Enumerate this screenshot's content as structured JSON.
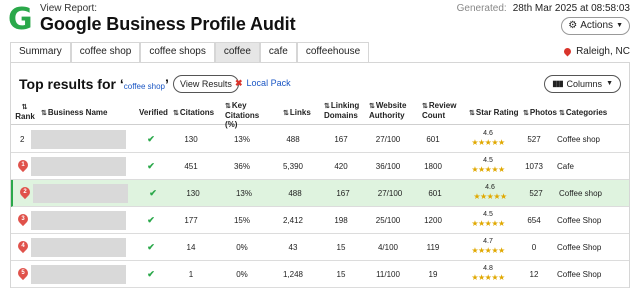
{
  "header": {
    "view_report": "View Report:",
    "title": "Google Business Profile Audit",
    "generated_label": "Generated:",
    "generated_date": "28th Mar 2025 at 08:58:03",
    "actions_label": "Actions"
  },
  "tabs": [
    {
      "label": "Summary",
      "active": false
    },
    {
      "label": "coffee shop",
      "active": false
    },
    {
      "label": "coffee shops",
      "active": false
    },
    {
      "label": "cafe",
      "active": true
    },
    {
      "label": "cafe",
      "active": false
    },
    {
      "label": "coffeehouse",
      "active": false
    }
  ],
  "location": "Raleigh, NC",
  "panel": {
    "heading": "Top results for",
    "keyword": "coffee shop",
    "view_results_label": "View Results",
    "local_pack_label": "Local Pack",
    "columns_label": "Columns"
  },
  "columns": {
    "rank": "Rank",
    "business_name": "Business Name",
    "verified": "Verified",
    "citations": "Citations",
    "key_citations": "Key Citations (%)",
    "links": "Links",
    "linking_domains": "Linking Domains",
    "website_authority": "Website Authority",
    "review_count": "Review Count",
    "star_rating": "Star Rating",
    "photos": "Photos",
    "categories": "Categories"
  },
  "rows": [
    {
      "rank": "2",
      "pinned": false,
      "verified": "✔",
      "citations": "130",
      "key_citations": "13%",
      "links": "488",
      "linking_domains": "167",
      "website_authority": "27/100",
      "review_count": "601",
      "rating": "4.6",
      "stars": "★★★★★",
      "photos": "527",
      "category": "Coffee shop",
      "highlight": false
    },
    {
      "rank": "1",
      "pinned": true,
      "verified": "✔",
      "citations": "451",
      "key_citations": "36%",
      "links": "5,390",
      "linking_domains": "420",
      "website_authority": "36/100",
      "review_count": "1800",
      "rating": "4.5",
      "stars": "★★★★★",
      "photos": "1073",
      "category": "Cafe",
      "highlight": false
    },
    {
      "rank": "2",
      "pinned": true,
      "verified": "✔",
      "citations": "130",
      "key_citations": "13%",
      "links": "488",
      "linking_domains": "167",
      "website_authority": "27/100",
      "review_count": "601",
      "rating": "4.6",
      "stars": "★★★★★",
      "photos": "527",
      "category": "Coffee shop",
      "highlight": true
    },
    {
      "rank": "3",
      "pinned": true,
      "verified": "✔",
      "citations": "177",
      "key_citations": "15%",
      "links": "2,412",
      "linking_domains": "198",
      "website_authority": "25/100",
      "review_count": "1200",
      "rating": "4.5",
      "stars": "★★★★★",
      "photos": "654",
      "category": "Coffee Shop",
      "highlight": false
    },
    {
      "rank": "4",
      "pinned": true,
      "verified": "✔",
      "citations": "14",
      "key_citations": "0%",
      "links": "43",
      "linking_domains": "15",
      "website_authority": "4/100",
      "review_count": "119",
      "rating": "4.7",
      "stars": "★★★★★",
      "photos": "0",
      "category": "Coffee Shop",
      "highlight": false
    },
    {
      "rank": "5",
      "pinned": true,
      "verified": "✔",
      "citations": "1",
      "key_citations": "0%",
      "links": "1,248",
      "linking_domains": "15",
      "website_authority": "11/100",
      "review_count": "19",
      "rating": "4.8",
      "stars": "★★★★★",
      "photos": "12",
      "category": "Coffee Shop",
      "highlight": false
    }
  ],
  "colors": {
    "brand_green": "#2aa84a",
    "pin_red": "#e0524b",
    "link_blue": "#1a56c4",
    "star_gold": "#e0a800",
    "highlight_row": "#dff3df"
  }
}
